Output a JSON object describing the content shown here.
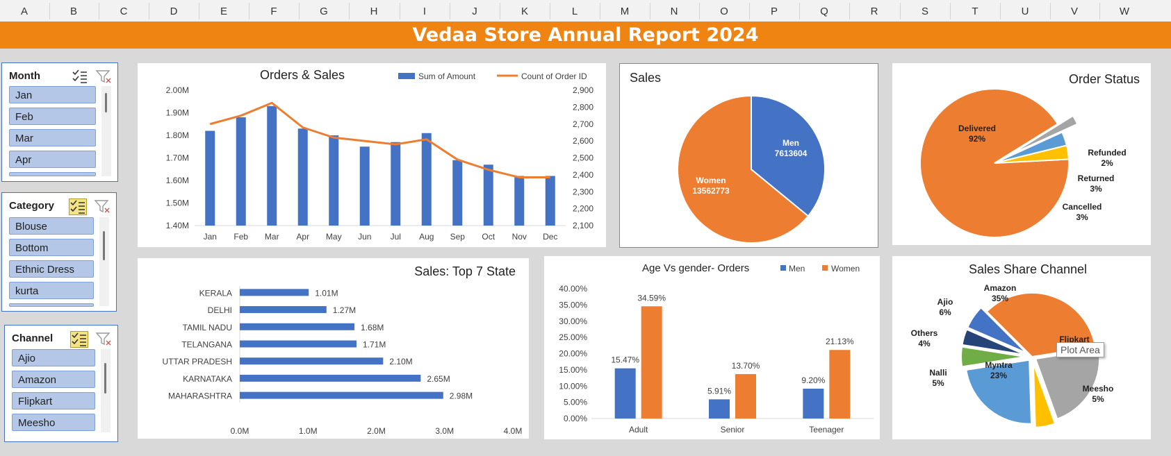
{
  "columns": [
    "A",
    "B",
    "C",
    "D",
    "E",
    "F",
    "G",
    "H",
    "I",
    "J",
    "K",
    "L",
    "M",
    "N",
    "O",
    "P",
    "Q",
    "R",
    "S",
    "T",
    "U",
    "V",
    "W"
  ],
  "report_title": "Vedaa Store Annual Report 2024",
  "slicers": {
    "month": {
      "title": "Month",
      "items": [
        "Jan",
        "Feb",
        "Mar",
        "Apr"
      ]
    },
    "category": {
      "title": "Category",
      "items": [
        "Blouse",
        "Bottom",
        "Ethnic Dress",
        "kurta"
      ]
    },
    "channel": {
      "title": "Channel",
      "items": [
        "Ajio",
        "Amazon",
        "Flipkart",
        "Meesho"
      ]
    }
  },
  "tooltip": "Plot Area",
  "colors": {
    "blue": "#4472c4",
    "orange": "#ed7d31",
    "gray": "#a5a5a5",
    "yellow": "#ffc000",
    "lightblue": "#5b9bd5",
    "green": "#70ad47",
    "navy": "#264478",
    "header": "#ef8412"
  },
  "chart_data": [
    {
      "id": "orders_sales",
      "type": "bar",
      "title": "Orders & Sales",
      "categories": [
        "Jan",
        "Feb",
        "Mar",
        "Apr",
        "May",
        "Jun",
        "Jul",
        "Aug",
        "Sep",
        "Oct",
        "Nov",
        "Dec"
      ],
      "series": [
        {
          "name": "Sum of Amount",
          "type": "bar",
          "axis": "left",
          "values": [
            1.82,
            1.88,
            1.93,
            1.83,
            1.8,
            1.75,
            1.77,
            1.81,
            1.69,
            1.67,
            1.62,
            1.62
          ]
        },
        {
          "name": "Count of Order ID",
          "type": "line",
          "axis": "right",
          "values": [
            2700,
            2750,
            2825,
            2680,
            2620,
            2600,
            2580,
            2610,
            2490,
            2430,
            2385,
            2385
          ]
        }
      ],
      "left_ticks": [
        "2.00M",
        "1.90M",
        "1.80M",
        "1.70M",
        "1.60M",
        "1.50M",
        "1.40M"
      ],
      "right_ticks": [
        "2,900",
        "2,800",
        "2,700",
        "2,600",
        "2,500",
        "2,400",
        "2,300",
        "2,200",
        "2,100"
      ],
      "ylim_left": [
        1.4,
        2.0
      ],
      "ylim_right": [
        2100,
        2900
      ]
    },
    {
      "id": "sales_gender",
      "type": "pie",
      "title": "Sales",
      "slices": [
        {
          "label": "Men",
          "value": 7613604,
          "value_label": "7613604"
        },
        {
          "label": "Women",
          "value": 13562773,
          "value_label": "13562773"
        }
      ]
    },
    {
      "id": "order_status",
      "type": "pie",
      "title": "Order Status",
      "slices": [
        {
          "label": "Delivered",
          "value": 92,
          "value_label": "92%"
        },
        {
          "label": "Refunded",
          "value": 2,
          "value_label": "2%"
        },
        {
          "label": "Returned",
          "value": 3,
          "value_label": "3%"
        },
        {
          "label": "Cancelled",
          "value": 3,
          "value_label": "3%"
        }
      ]
    },
    {
      "id": "top_states",
      "type": "bar",
      "orientation": "horizontal",
      "title": "Sales: Top 7 State",
      "categories": [
        "KERALA",
        "DELHI",
        "TAMIL NADU",
        "TELANGANA",
        "UTTAR PRADESH",
        "KARNATAKA",
        "MAHARASHTRA"
      ],
      "values": [
        1.01,
        1.27,
        1.68,
        1.71,
        2.1,
        2.65,
        2.98
      ],
      "value_labels": [
        "1.01M",
        "1.27M",
        "1.68M",
        "1.71M",
        "2.10M",
        "2.65M",
        "2.98M"
      ],
      "x_ticks": [
        "0.0M",
        "1.0M",
        "2.0M",
        "3.0M",
        "4.0M"
      ],
      "xlim": [
        0,
        4
      ]
    },
    {
      "id": "age_gender",
      "type": "bar",
      "title": "Age Vs gender- Orders",
      "categories": [
        "Adult",
        "Senior",
        "Teenager"
      ],
      "series": [
        {
          "name": "Men",
          "values": [
            15.47,
            5.91,
            9.2
          ],
          "value_labels": [
            "15.47%",
            "5.91%",
            "9.20%"
          ]
        },
        {
          "name": "Women",
          "values": [
            34.59,
            13.7,
            21.13
          ],
          "value_labels": [
            "34.59%",
            "13.70%",
            "21.13%"
          ]
        }
      ],
      "y_ticks": [
        "40.00%",
        "35.00%",
        "30.00%",
        "25.00%",
        "20.00%",
        "15.00%",
        "10.00%",
        "5.00%",
        "0.00%"
      ],
      "ylim": [
        0,
        40
      ]
    },
    {
      "id": "sales_channel",
      "type": "pie",
      "title": "Sales Share Channel",
      "slices": [
        {
          "label": "Amazon",
          "value": 35,
          "value_label": "35%"
        },
        {
          "label": "Flipkart",
          "value": 22,
          "value_label": "22%"
        },
        {
          "label": "Meesho",
          "value": 5,
          "value_label": "5%"
        },
        {
          "label": "Myntra",
          "value": 23,
          "value_label": "23%"
        },
        {
          "label": "Nalli",
          "value": 5,
          "value_label": "5%"
        },
        {
          "label": "Others",
          "value": 4,
          "value_label": "4%"
        },
        {
          "label": "Ajio",
          "value": 6,
          "value_label": "6%"
        }
      ]
    }
  ]
}
